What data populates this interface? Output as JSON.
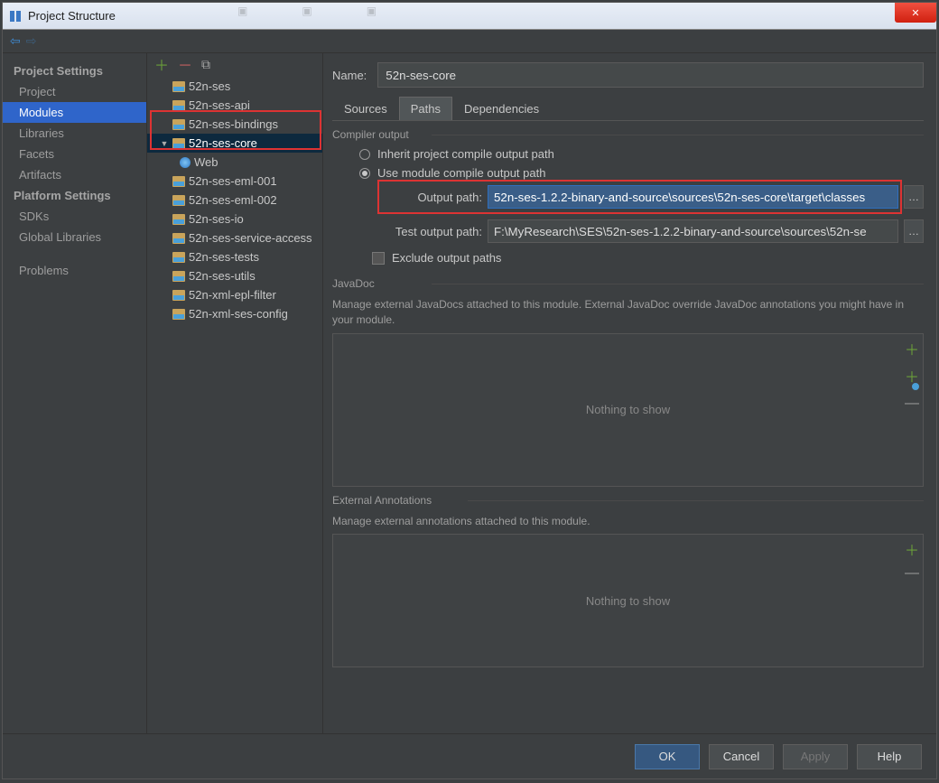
{
  "window": {
    "title": "Project Structure"
  },
  "sidebar": {
    "heading1": "Project Settings",
    "items1": [
      "Project",
      "Modules",
      "Libraries",
      "Facets",
      "Artifacts"
    ],
    "selected1": "Modules",
    "heading2": "Platform Settings",
    "items2": [
      "SDKs",
      "Global Libraries"
    ],
    "heading3": "Problems"
  },
  "tree": {
    "items": [
      {
        "label": "52n-ses"
      },
      {
        "label": "52n-ses-api"
      },
      {
        "label": "52n-ses-bindings"
      },
      {
        "label": "52n-ses-core",
        "selected": true,
        "expanded": true,
        "children": [
          {
            "label": "Web",
            "web": true
          }
        ]
      },
      {
        "label": "52n-ses-eml-001"
      },
      {
        "label": "52n-ses-eml-002"
      },
      {
        "label": "52n-ses-io"
      },
      {
        "label": "52n-ses-service-access"
      },
      {
        "label": "52n-ses-tests"
      },
      {
        "label": "52n-ses-utils"
      },
      {
        "label": "52n-xml-epl-filter"
      },
      {
        "label": "52n-xml-ses-config"
      }
    ]
  },
  "main": {
    "name_label": "Name:",
    "name_value": "52n-ses-core",
    "tabs": [
      "Sources",
      "Paths",
      "Dependencies"
    ],
    "active_tab": "Paths",
    "compiler": {
      "title": "Compiler output",
      "radio_inherit": "Inherit project compile output path",
      "radio_module": "Use module compile output path",
      "output_label": "Output path:",
      "output_value": "52n-ses-1.2.2-binary-and-source\\sources\\52n-ses-core\\target\\classes",
      "test_label": "Test output path:",
      "test_value": "F:\\MyResearch\\SES\\52n-ses-1.2.2-binary-and-source\\sources\\52n-se",
      "exclude": "Exclude output paths"
    },
    "javadoc": {
      "title": "JavaDoc",
      "desc": "Manage external JavaDocs attached to this module. External JavaDoc override JavaDoc annotations you might have in your module.",
      "empty": "Nothing to show"
    },
    "annotations": {
      "title": "External Annotations",
      "desc": "Manage external annotations attached to this module.",
      "empty": "Nothing to show"
    }
  },
  "footer": {
    "ok": "OK",
    "cancel": "Cancel",
    "apply": "Apply",
    "help": "Help"
  }
}
